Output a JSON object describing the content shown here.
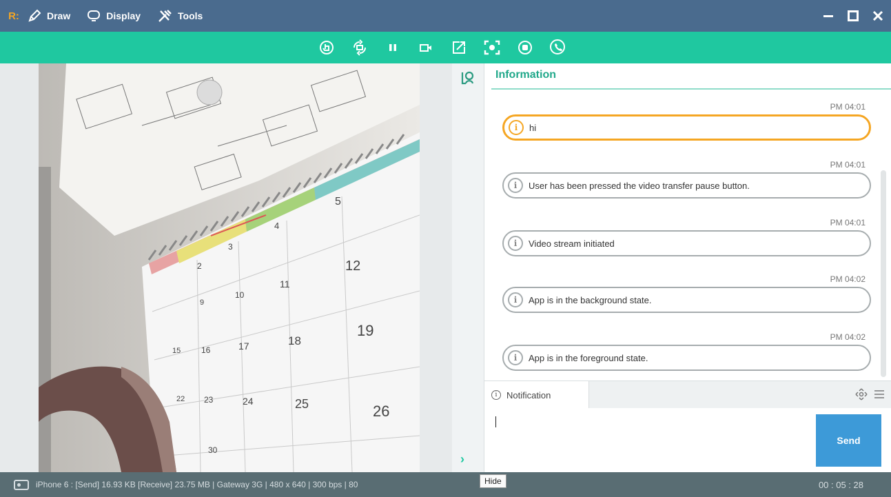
{
  "app": {
    "logo": "R:",
    "menu": [
      {
        "label": "Draw",
        "icon": "pen-icon"
      },
      {
        "label": "Display",
        "icon": "monitor-icon"
      },
      {
        "label": "Tools",
        "icon": "tools-icon"
      }
    ],
    "window_controls": [
      "minimize-icon",
      "maximize-icon",
      "close-icon"
    ]
  },
  "toolbar": {
    "icons": [
      "hand-tap-icon",
      "rotate-icon",
      "pause-icon",
      "video-camera-icon",
      "share-icon",
      "screenshot-icon",
      "record-icon",
      "phone-icon"
    ]
  },
  "panel": {
    "title": "Information",
    "messages": [
      {
        "time": "PM 04:01",
        "text": "hi",
        "active": true
      },
      {
        "time": "PM 04:01",
        "text": "User has been pressed the video transfer pause button.",
        "active": false
      },
      {
        "time": "PM 04:01",
        "text": "Video stream initiated",
        "active": false
      },
      {
        "time": "PM 04:02",
        "text": "App is in the background state.",
        "active": false
      },
      {
        "time": "PM 04:02",
        "text": "App is in the foreground state.",
        "active": false
      }
    ],
    "notification_tab": "Notification",
    "send_label": "Send",
    "expand_glyph": "›"
  },
  "status": {
    "text": "iPhone 6 : [Send] 16.93 KB  [Receive] 23.75 MB | Gateway 3G | 480 x 640 | 300 bps | 80",
    "tooltip": "Hide",
    "elapsed": "00 : 05 : 28"
  },
  "colors": {
    "titlebar": "#4a6b8e",
    "toolbar": "#1fc8a0",
    "accent_orange": "#f5a623",
    "send_blue": "#3d9ad8",
    "statusbar": "#596d73"
  },
  "video": {
    "calendar_dates": [
      "2",
      "3",
      "4",
      "5",
      "9",
      "10",
      "11",
      "12",
      "15",
      "16",
      "17",
      "18",
      "19",
      "22",
      "23",
      "24",
      "25",
      "26",
      "30"
    ]
  }
}
